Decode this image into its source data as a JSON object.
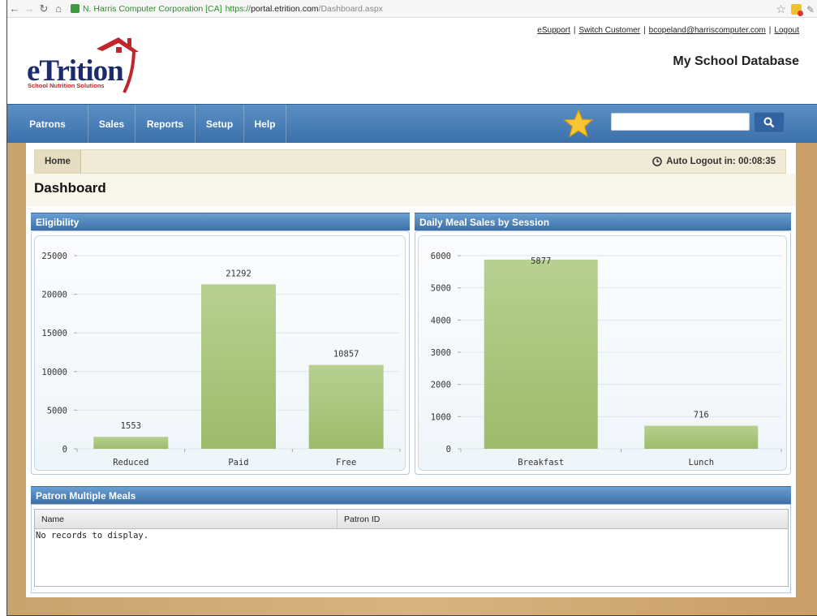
{
  "browser": {
    "ev_label": "N. Harris Computer Corporation [CA]",
    "url_scheme": "https://",
    "url_host": "portal.etrition.com",
    "url_path": "/Dashboard.aspx"
  },
  "top_links": {
    "esupport": "eSupport",
    "switch_customer": "Switch Customer",
    "user_email": "bcopeland@harriscomputer.com",
    "logout": "Logout",
    "separator": "|"
  },
  "header": {
    "logo_text": "eTrition",
    "logo_tagline": "School Nutrition Solutions",
    "database_title": "My School Database"
  },
  "nav": {
    "items": [
      {
        "label": "Patrons"
      },
      {
        "label": "Sales"
      },
      {
        "label": "Reports"
      },
      {
        "label": "Setup"
      },
      {
        "label": "Help"
      }
    ],
    "search_placeholder": "",
    "favorites_icon": "star-icon",
    "search_icon": "search-icon"
  },
  "breadcrumb": {
    "home": "Home"
  },
  "auto_logout": {
    "label": "Auto Logout in: 00:08:35"
  },
  "page": {
    "title": "Dashboard"
  },
  "panels": {
    "eligibility_title": "Eligibility",
    "daily_sales_title": "Daily Meal Sales by Session",
    "patron_multiple_title": "Patron Multiple Meals"
  },
  "chart_data": [
    {
      "type": "bar",
      "title": "Eligibility",
      "categories": [
        "Reduced",
        "Paid",
        "Free"
      ],
      "values": [
        1553,
        21292,
        10857
      ],
      "ylim": [
        0,
        25000
      ],
      "yticks": [
        0,
        5000,
        10000,
        15000,
        20000,
        25000
      ],
      "grid": true,
      "bar_color": "#9cbc6a"
    },
    {
      "type": "bar",
      "title": "Daily Meal Sales by Session",
      "categories": [
        "Breakfast",
        "Lunch"
      ],
      "values": [
        5877,
        716
      ],
      "ylim": [
        0,
        6000
      ],
      "yticks": [
        0,
        1000,
        2000,
        3000,
        4000,
        5000,
        6000
      ],
      "grid": true,
      "bar_color": "#9cbc6a"
    }
  ],
  "patron_table": {
    "columns": [
      "Name",
      "Patron ID"
    ],
    "empty_text": "No records to display."
  },
  "colors": {
    "nav_blue": "#3b70ab",
    "panel_blue": "#4a7cb3",
    "bar_green": "#9cbc6a",
    "logo_navy": "#1b2b6b",
    "logo_red": "#c0262b"
  }
}
